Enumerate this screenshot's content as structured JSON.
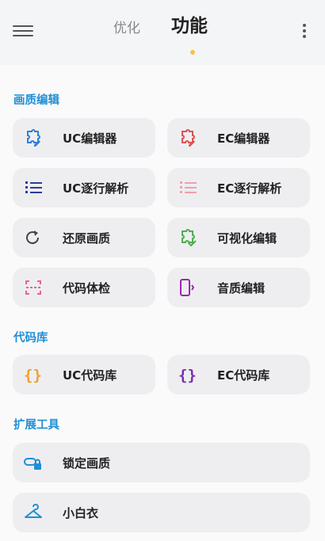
{
  "header": {
    "tabs": [
      {
        "label": "优化",
        "active": false
      },
      {
        "label": "功能",
        "active": true
      }
    ],
    "accent_color": "#f5c542"
  },
  "sections": [
    {
      "title": "画质编辑",
      "items": [
        {
          "label": "UC编辑器",
          "icon": "puzzle-edit-icon",
          "color": "#2f7fd6"
        },
        {
          "label": "EC编辑器",
          "icon": "puzzle-edit-icon",
          "color": "#e05050"
        },
        {
          "label": "UC逐行解析",
          "icon": "list-icon",
          "color": "#2c3e9a"
        },
        {
          "label": "EC逐行解析",
          "icon": "list-icon",
          "color": "#f0a0a8"
        },
        {
          "label": "还原画质",
          "icon": "refresh-icon",
          "color": "#444444"
        },
        {
          "label": "可视化编辑",
          "icon": "puzzle-check-icon",
          "color": "#4caf50"
        },
        {
          "label": "代码体检",
          "icon": "scan-icon",
          "color": "#f06090"
        },
        {
          "label": "音质编辑",
          "icon": "phone-sound-icon",
          "color": "#9c27b0"
        }
      ]
    },
    {
      "title": "代码库",
      "items": [
        {
          "label": "UC代码库",
          "icon": "braces-icon",
          "color": "#f0a030"
        },
        {
          "label": "EC代码库",
          "icon": "braces-icon",
          "color": "#7b2fb0"
        }
      ]
    },
    {
      "title": "扩展工具",
      "items": [
        {
          "label": "锁定画质",
          "icon": "link-lock-icon",
          "color": "#1f8fd6"
        },
        {
          "label": "小白衣",
          "icon": "hanger-icon",
          "color": "#1f8fd6"
        }
      ]
    }
  ]
}
